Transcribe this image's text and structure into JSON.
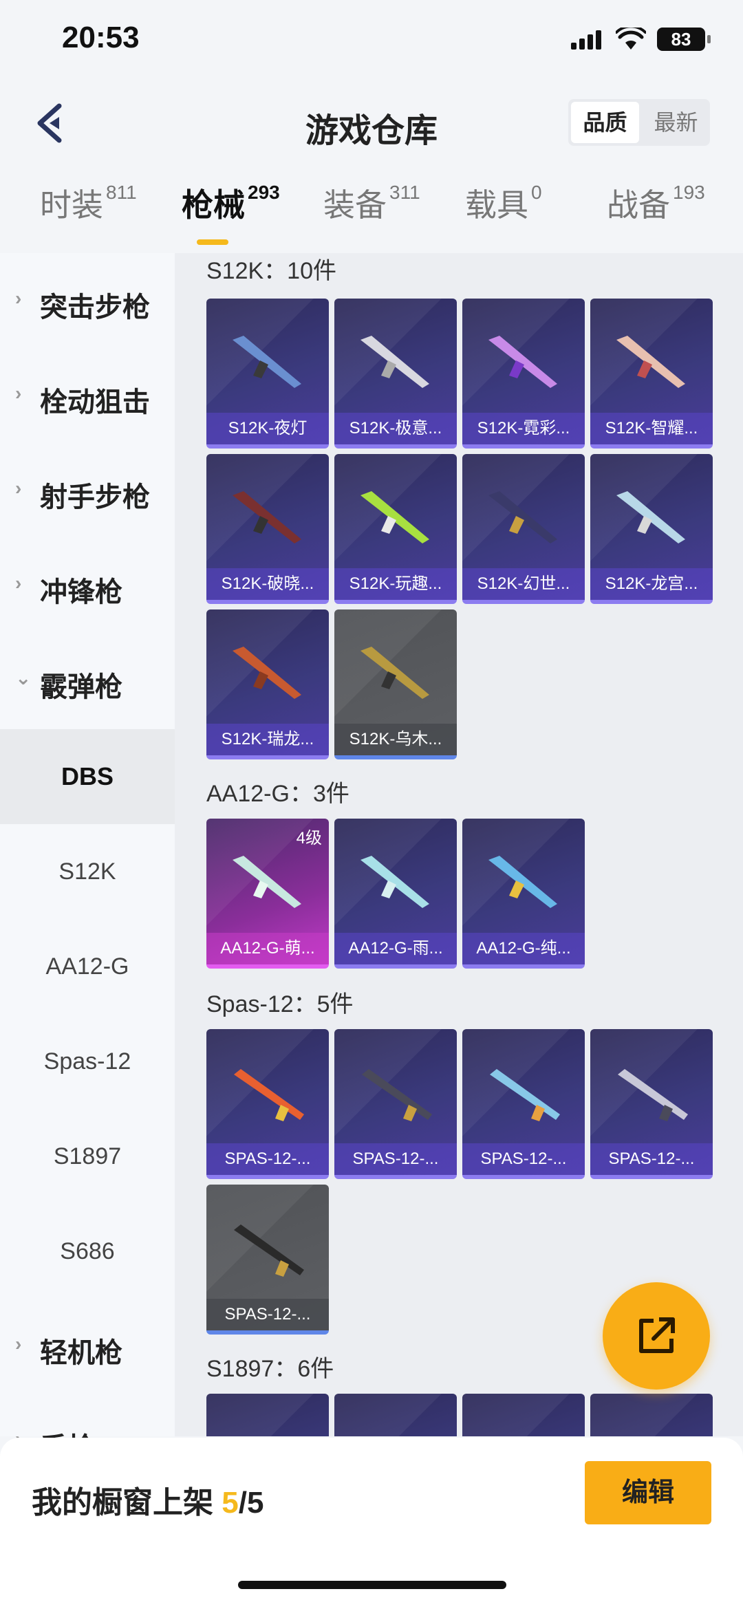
{
  "status": {
    "time": "20:53",
    "battery": "83"
  },
  "header": {
    "title": "游戏仓库",
    "sort_quality": "品质",
    "sort_newest": "最新"
  },
  "tabs": [
    {
      "label": "时装",
      "count": "811"
    },
    {
      "label": "枪械",
      "count": "293"
    },
    {
      "label": "装备",
      "count": "311"
    },
    {
      "label": "载具",
      "count": "0"
    },
    {
      "label": "战备",
      "count": "193"
    }
  ],
  "sidebar": {
    "categories": [
      "突击步枪",
      "栓动狙击",
      "射手步枪",
      "冲锋枪",
      "霰弹枪"
    ],
    "subcategories": [
      "DBS",
      "S12K",
      "AA12-G",
      "Spas-12",
      "S1897",
      "S686"
    ],
    "after": [
      "轻机枪",
      "手枪"
    ]
  },
  "sections": [
    {
      "title": "S12K：10件",
      "items": [
        "S12K-夜灯",
        "S12K-极意...",
        "S12K-霓彩...",
        "S12K-智耀...",
        "S12K-破晓...",
        "S12K-玩趣...",
        "S12K-幻世...",
        "S12K-龙宫...",
        "S12K-瑞龙...",
        "S12K-乌木..."
      ]
    },
    {
      "title": "AA12-G：3件",
      "items": [
        "AA12-G-萌...",
        "AA12-G-雨...",
        "AA12-G-纯..."
      ],
      "level": "4级"
    },
    {
      "title": "Spas-12：5件",
      "items": [
        "SPAS-12-...",
        "SPAS-12-...",
        "SPAS-12-...",
        "SPAS-12-...",
        "SPAS-12-..."
      ]
    },
    {
      "title": "S1897：6件"
    }
  ],
  "bottom": {
    "label": "我的橱窗上架 ",
    "current": "5",
    "total": "/5",
    "edit": "编辑"
  }
}
